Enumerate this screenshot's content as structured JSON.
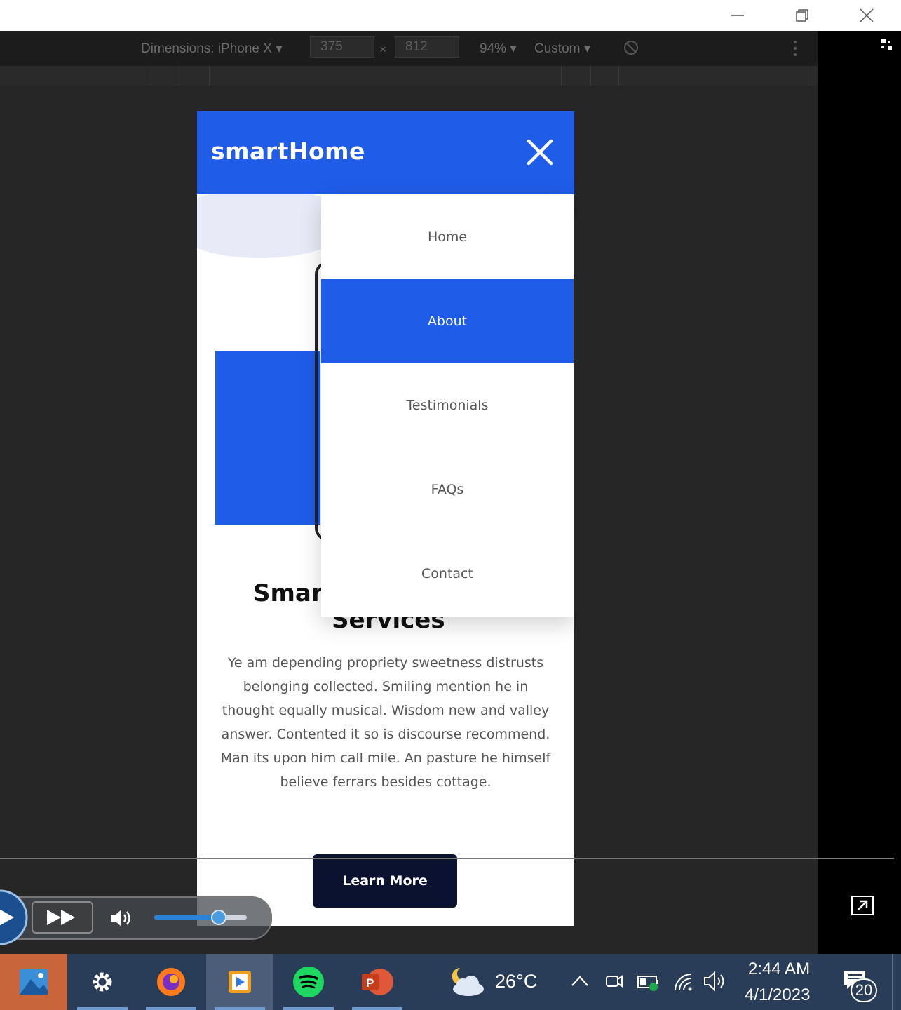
{
  "devtools": {
    "dimensions_label": "Dimensions: iPhone X",
    "width_value": "375",
    "times_sign": "×",
    "height_value": "812",
    "zoom": "94%",
    "throttle": "Custom"
  },
  "page": {
    "brand": "smartHome",
    "menu": [
      "Home",
      "About",
      "Testimonials",
      "FAQs",
      "Contact"
    ],
    "active_menu_item": "About",
    "heading_partial_1": "Smar",
    "heading_partial_2": "Services",
    "paragraph": "Ye am depending propriety sweetness distrusts belonging collected. Smiling mention he in thought equally musical. Wisdom new and valley answer. Contented it so is discourse recommend. Man its upon him call mile. An pasture he himself believe ferrars besides cottage.",
    "cta": "Learn More",
    "accent_color": "#1f5ce8",
    "cta_color": "#0b1230"
  },
  "media_player": {
    "volume_level": 0.7
  },
  "taskbar": {
    "apps": [
      "photos-icon",
      "settings-icon",
      "firefox-icon",
      "media-player-icon",
      "spotify-icon",
      "powerpoint-icon"
    ],
    "temperature": "26°C",
    "time": "2:44 AM",
    "date": "4/1/2023",
    "notification_count": "20"
  }
}
